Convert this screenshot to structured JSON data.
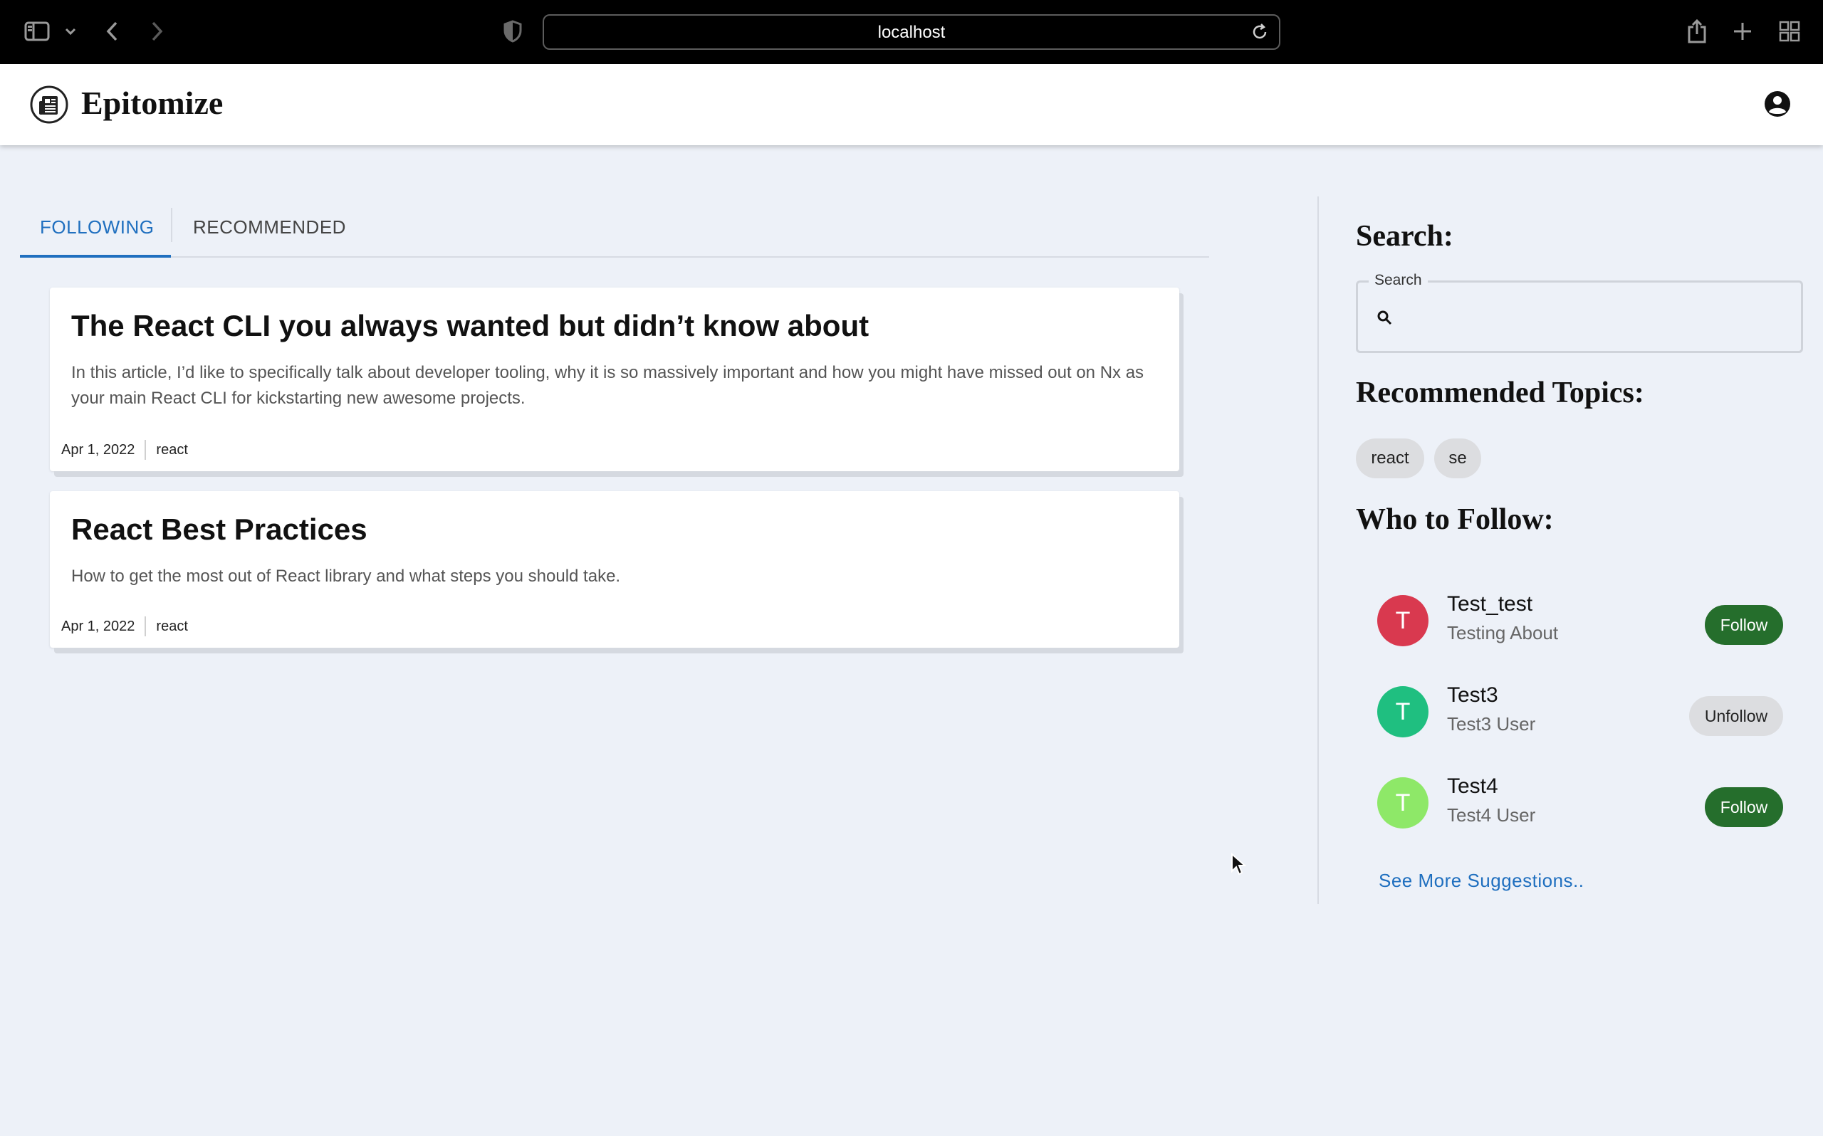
{
  "browser": {
    "url": "localhost"
  },
  "app": {
    "brand": "Epitomize"
  },
  "tabs": [
    {
      "label": "FOLLOWING",
      "active": true
    },
    {
      "label": "RECOMMENDED",
      "active": false
    }
  ],
  "articles": [
    {
      "title": "The React CLI you always wanted but didn’t know about",
      "description": "In this article, I’d like to specifically talk about developer tooling, why it is so massively important and how you might have missed out on Nx as your main React CLI for kickstarting new awesome projects.",
      "date": "Apr 1, 2022",
      "tag": "react"
    },
    {
      "title": "React Best Practices",
      "description": "How to get the most out of React library and what steps you should take.",
      "date": "Apr 1, 2022",
      "tag": "react"
    }
  ],
  "sidebar": {
    "search_heading": "Search:",
    "search_label": "Search",
    "search_value": "",
    "topics_heading": "Recommended Topics:",
    "topics": [
      "react",
      "se"
    ],
    "follow_heading": "Who to Follow:",
    "users": [
      {
        "initial": "T",
        "name": "Test_test",
        "bio": "Testing About",
        "action": "Follow",
        "avatar_color": "#d9394f"
      },
      {
        "initial": "T",
        "name": "Test3",
        "bio": "Test3 User",
        "action": "Unfollow",
        "avatar_color": "#1fbf80"
      },
      {
        "initial": "T",
        "name": "Test4",
        "bio": "Test4 User",
        "action": "Follow",
        "avatar_color": "#8ee868"
      }
    ],
    "see_more": "See More Suggestions.."
  },
  "colors": {
    "accent": "#1f6fbf",
    "follow_button": "#256e2c",
    "page_background": "#edf1f8"
  }
}
